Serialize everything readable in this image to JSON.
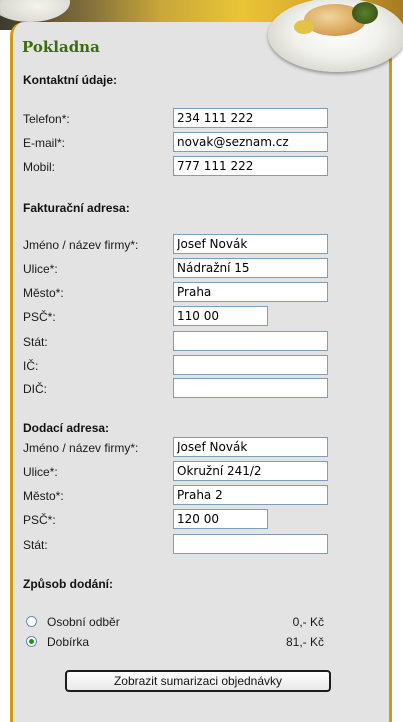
{
  "page": {
    "title": "Pokladna"
  },
  "contact": {
    "heading": "Kontaktní údaje:",
    "fields": [
      {
        "label": "Telefon*:",
        "value": "234 111 222"
      },
      {
        "label": "E-mail*:",
        "value": "novak@seznam.cz"
      },
      {
        "label": "Mobil:",
        "value": "777 111 222"
      }
    ]
  },
  "billing": {
    "heading": "Fakturační adresa:",
    "fields": [
      {
        "label": "Jméno / název firmy*:",
        "value": "Josef Novák"
      },
      {
        "label": "Ulice*:",
        "value": "Nádražní 15"
      },
      {
        "label": "Město*:",
        "value": "Praha"
      },
      {
        "label": "PSČ*:",
        "value": "110 00"
      },
      {
        "label": "Stát:",
        "value": ""
      },
      {
        "label": "IČ:",
        "value": ""
      },
      {
        "label": "DIČ:",
        "value": ""
      }
    ]
  },
  "delivery": {
    "heading": "Dodací adresa:",
    "fields": [
      {
        "label": "Jméno / název firmy*:",
        "value": "Josef Novák"
      },
      {
        "label": "Ulice*:",
        "value": "Okružní 241/2"
      },
      {
        "label": "Město*:",
        "value": "Praha 2"
      },
      {
        "label": "PSČ*:",
        "value": "120 00"
      },
      {
        "label": "Stát:",
        "value": ""
      }
    ]
  },
  "shipping": {
    "heading": "Způsob dodání:",
    "options": [
      {
        "label": "Osobní odběr",
        "price": "0,- Kč",
        "selected": false
      },
      {
        "label": "Dobírka",
        "price": "81,- Kč",
        "selected": true
      }
    ]
  },
  "summary_button": {
    "label": "Zobrazit sumarizaci objednávky"
  },
  "colors": {
    "title_green": "#3d6b12",
    "frame_gold": "#c99b16",
    "panel_gray": "#e3e3e3",
    "radio_selected": "#1f8f1f"
  }
}
